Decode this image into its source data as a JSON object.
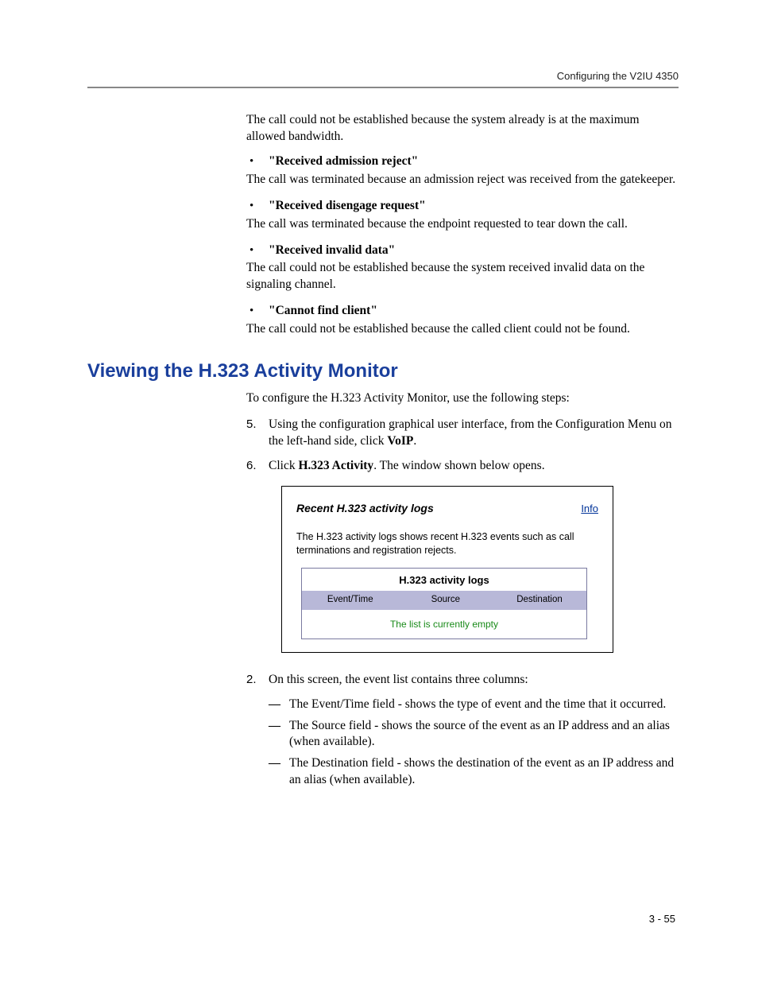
{
  "header": {
    "running_title": "Configuring the V2IU 4350"
  },
  "intro_para": "The call could not be established because the system already is at the maximum allowed bandwidth.",
  "bullets": [
    {
      "label": "\"Received admission reject\"",
      "desc": "The call was terminated because an admission reject was received from the gatekeeper."
    },
    {
      "label": "\"Received disengage request\"",
      "desc": "The call was terminated because the endpoint requested to tear down the call."
    },
    {
      "label": "\"Received invalid data\"",
      "desc": "The call could not be established because the system received invalid data on the signaling channel."
    },
    {
      "label": "\"Cannot find client\"",
      "desc": "The call could not be established because the called client could not be found."
    }
  ],
  "section": {
    "title": "Viewing the H.323 Activity Monitor",
    "intro": "To configure the H.323 Activity Monitor, use the following steps:"
  },
  "steps": {
    "five": {
      "marker": "5.",
      "pre": "Using the configuration graphical user interface, from the Configuration Menu on the left-hand side, click ",
      "bold": "VoIP",
      "post": "."
    },
    "six": {
      "marker": "6.",
      "pre": "Click ",
      "bold": "H.323 Activity",
      "post": ". The window shown below opens."
    },
    "two": {
      "marker": "2.",
      "text": "On this screen, the event list contains three columns:"
    }
  },
  "sub_items": [
    "The Event/Time field - shows the type of event and the time that it occurred.",
    "The Source field - shows the source of the event as an IP address and an alias (when available).",
    "The Destination field - shows the destination of the event as an IP address and an alias (when available)."
  ],
  "panel": {
    "title": "Recent H.323 activity logs",
    "info": "Info",
    "desc": "The H.323 activity logs shows recent H.323 events such as call terminations and registration rejects.",
    "table_caption": "H.323 activity logs",
    "cols": {
      "c1": "Event/Time",
      "c2": "Source",
      "c3": "Destination"
    },
    "empty": "The list is currently empty"
  },
  "footer": {
    "page": "3 - 55"
  }
}
